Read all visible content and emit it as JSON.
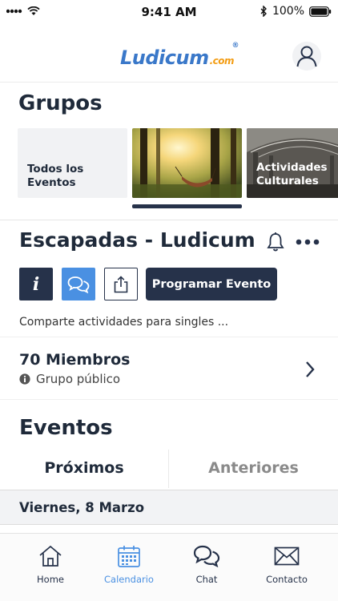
{
  "status_bar": {
    "time": "9:41 AM",
    "battery": "100%"
  },
  "header": {
    "logo_main": "Ludicum",
    "logo_suffix": ".com",
    "logo_reg": "®"
  },
  "groups_section": {
    "title": "Grupos",
    "cards": [
      {
        "label_line1": "Todos los",
        "label_line2": "Eventos"
      },
      {
        "label_line1": "",
        "label_line2": ""
      },
      {
        "label_line1": "Actividades",
        "label_line2": "Culturales"
      }
    ]
  },
  "group": {
    "title": "Escapadas - Ludicum",
    "schedule_button": "Programar Evento",
    "description": "Comparte actividades para singles ...",
    "members": "70 Miembros",
    "visibility": "Grupo público"
  },
  "events_section": {
    "title": "Eventos",
    "tabs": [
      {
        "label": "Próximos",
        "active": true
      },
      {
        "label": "Anteriores",
        "active": false
      }
    ],
    "date_header": "Viernes, 8 Marzo"
  },
  "tabbar": {
    "items": [
      {
        "label": "Home",
        "icon": "home-icon",
        "active": false
      },
      {
        "label": "Calendario",
        "icon": "calendar-icon",
        "active": true
      },
      {
        "label": "Chat",
        "icon": "chat-icon",
        "active": false
      },
      {
        "label": "Contacto",
        "icon": "mail-icon",
        "active": false
      }
    ]
  },
  "colors": {
    "dark_navy": "#26324a",
    "accent_blue": "#4a90e2",
    "logo_orange": "#f39c12"
  }
}
